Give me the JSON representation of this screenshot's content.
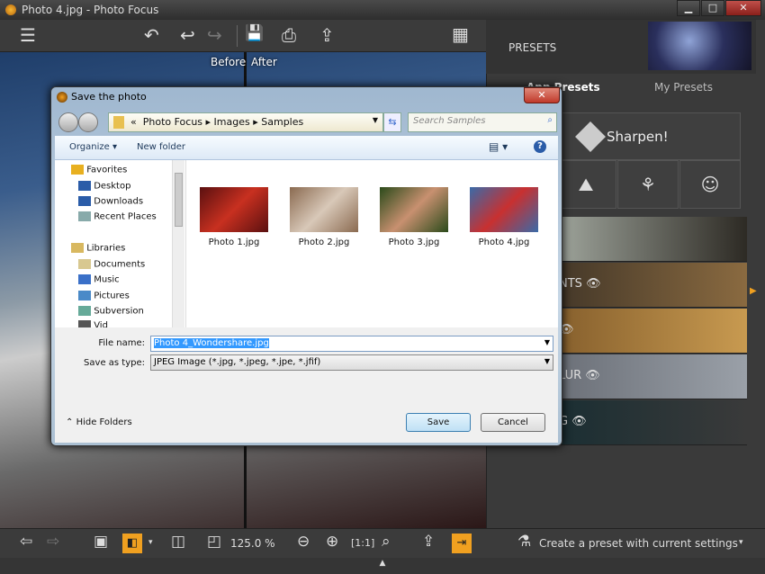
{
  "window": {
    "title": "Photo 4.jpg - Photo Focus",
    "min": "▁",
    "max": "□",
    "close": "✕"
  },
  "toolbar": {
    "menu": "☰",
    "undo": "↶",
    "undo2": "↩",
    "redo": "↪",
    "save": "💾",
    "print": "⎙",
    "share": "⇪",
    "grid": "▦"
  },
  "view": {
    "before": "Before",
    "after": "After"
  },
  "panel": {
    "title": "PRESETS",
    "tabs": [
      "App Presets",
      "My Presets"
    ],
    "sharpen": "Sharpen!",
    "filters": [
      "landscape-icon",
      "flower-icon",
      "portrait-icon"
    ],
    "strips": [
      {
        "label": "",
        "colors": [
          "#c9d2c8",
          "#2d2a24"
        ]
      },
      {
        "label": "NTS",
        "colors": [
          "#2a2520",
          "#8a6a40"
        ]
      },
      {
        "label": "",
        "colors": [
          "#6e4a20",
          "#c89a50"
        ]
      },
      {
        "label": "LUR",
        "colors": [
          "#5a5e66",
          "#9aa0a8"
        ]
      },
      {
        "label": "G",
        "colors": [
          "#0f2a30",
          "#3a3a3a"
        ]
      }
    ]
  },
  "bottom": {
    "zoom": "125.0 %",
    "one_to_one": "[1:1]",
    "create_preset": "Create a preset with current settings"
  },
  "dialog": {
    "title": "Save the photo",
    "breadcrumb": [
      "Photo Focus",
      "Images",
      "Samples"
    ],
    "search_placeholder": "Search Samples",
    "organize": "Organize ▾",
    "new_folder": "New folder",
    "nav": [
      {
        "label": "Favorites",
        "level": 0,
        "color": "#e8b020"
      },
      {
        "label": "Desktop",
        "level": 1,
        "color": "#2a5ca8"
      },
      {
        "label": "Downloads",
        "level": 1,
        "color": "#2a5ca8"
      },
      {
        "label": "Recent Places",
        "level": 1,
        "color": "#8aa"
      },
      {
        "label": "Libraries",
        "level": 0,
        "color": "#d8b860"
      },
      {
        "label": "Documents",
        "level": 1,
        "color": "#d8c890"
      },
      {
        "label": "Music",
        "level": 1,
        "color": "#3a70c8"
      },
      {
        "label": "Pictures",
        "level": 1,
        "color": "#4a8ac8"
      },
      {
        "label": "Subversion",
        "level": 1,
        "color": "#6a9"
      },
      {
        "label": "Vid",
        "level": 1,
        "color": "#555"
      }
    ],
    "files": [
      {
        "name": "Photo 1.jpg",
        "colors": [
          "#5a1010",
          "#c83020"
        ]
      },
      {
        "name": "Photo 2.jpg",
        "colors": [
          "#8a6a50",
          "#d8c8b8"
        ]
      },
      {
        "name": "Photo 3.jpg",
        "colors": [
          "#2a4a1a",
          "#c89070"
        ]
      },
      {
        "name": "Photo 4.jpg",
        "colors": [
          "#3a6aa8",
          "#c83030"
        ]
      }
    ],
    "file_name_label": "File name:",
    "file_name": "Photo 4_Wondershare.jpg",
    "save_type_label": "Save as type:",
    "save_type": "JPEG Image (*.jpg, *.jpeg, *.jpe, *.jfif)",
    "hide_folders": "Hide Folders",
    "save": "Save",
    "cancel": "Cancel"
  }
}
